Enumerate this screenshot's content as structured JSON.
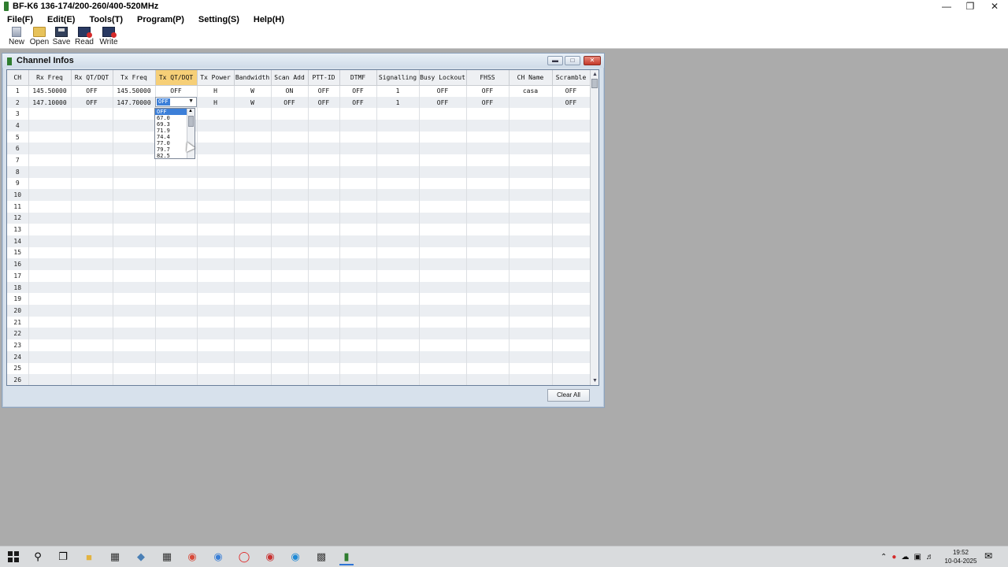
{
  "window": {
    "title": "BF-K6    136-174/200-260/400-520MHz",
    "min_icon": "minimize-icon",
    "max_icon": "restore-icon",
    "close_icon": "close-icon"
  },
  "menu": [
    {
      "label": "File(F)"
    },
    {
      "label": "Edit(E)"
    },
    {
      "label": "Tools(T)"
    },
    {
      "label": "Program(P)"
    },
    {
      "label": "Setting(S)"
    },
    {
      "label": "Help(H)"
    }
  ],
  "toolbar": {
    "new_label": "New",
    "open_label": "Open",
    "save_label": "Save",
    "read_label": "Read",
    "write_label": "Write"
  },
  "channel_window": {
    "title": "Channel Infos",
    "clear_all_label": "Clear All"
  },
  "table": {
    "columns": [
      "CH",
      "Rx Freq",
      "Rx QT/DQT",
      "Tx Freq",
      "Tx QT/DQT",
      "Tx Power",
      "Bandwidth",
      "Scan Add",
      "PTT-ID",
      "DTMF",
      "Signalling",
      "Busy Lockout",
      "FHSS",
      "CH Name",
      "Scramble"
    ],
    "active_column": "Tx QT/DQT",
    "rows": [
      [
        "1",
        "145.50000",
        "OFF",
        "145.50000",
        "OFF",
        "H",
        "W",
        "ON",
        "OFF",
        "OFF",
        "1",
        "OFF",
        "OFF",
        "casa",
        "OFF"
      ],
      [
        "2",
        "147.10000",
        "OFF",
        "147.70000",
        "",
        "H",
        "W",
        "OFF",
        "OFF",
        "OFF",
        "1",
        "OFF",
        "OFF",
        "",
        "OFF"
      ],
      [
        "3",
        "",
        "",
        "",
        "",
        "",
        "",
        "",
        "",
        "",
        "",
        "",
        "",
        "",
        ""
      ],
      [
        "4",
        "",
        "",
        "",
        "",
        "",
        "",
        "",
        "",
        "",
        "",
        "",
        "",
        "",
        ""
      ],
      [
        "5",
        "",
        "",
        "",
        "",
        "",
        "",
        "",
        "",
        "",
        "",
        "",
        "",
        "",
        ""
      ],
      [
        "6",
        "",
        "",
        "",
        "",
        "",
        "",
        "",
        "",
        "",
        "",
        "",
        "",
        "",
        ""
      ],
      [
        "7",
        "",
        "",
        "",
        "",
        "",
        "",
        "",
        "",
        "",
        "",
        "",
        "",
        "",
        ""
      ],
      [
        "8",
        "",
        "",
        "",
        "",
        "",
        "",
        "",
        "",
        "",
        "",
        "",
        "",
        "",
        ""
      ],
      [
        "9",
        "",
        "",
        "",
        "",
        "",
        "",
        "",
        "",
        "",
        "",
        "",
        "",
        "",
        ""
      ],
      [
        "10",
        "",
        "",
        "",
        "",
        "",
        "",
        "",
        "",
        "",
        "",
        "",
        "",
        "",
        ""
      ],
      [
        "11",
        "",
        "",
        "",
        "",
        "",
        "",
        "",
        "",
        "",
        "",
        "",
        "",
        "",
        ""
      ],
      [
        "12",
        "",
        "",
        "",
        "",
        "",
        "",
        "",
        "",
        "",
        "",
        "",
        "",
        "",
        ""
      ],
      [
        "13",
        "",
        "",
        "",
        "",
        "",
        "",
        "",
        "",
        "",
        "",
        "",
        "",
        "",
        ""
      ],
      [
        "14",
        "",
        "",
        "",
        "",
        "",
        "",
        "",
        "",
        "",
        "",
        "",
        "",
        "",
        ""
      ],
      [
        "15",
        "",
        "",
        "",
        "",
        "",
        "",
        "",
        "",
        "",
        "",
        "",
        "",
        "",
        ""
      ],
      [
        "16",
        "",
        "",
        "",
        "",
        "",
        "",
        "",
        "",
        "",
        "",
        "",
        "",
        "",
        ""
      ],
      [
        "17",
        "",
        "",
        "",
        "",
        "",
        "",
        "",
        "",
        "",
        "",
        "",
        "",
        "",
        ""
      ],
      [
        "18",
        "",
        "",
        "",
        "",
        "",
        "",
        "",
        "",
        "",
        "",
        "",
        "",
        "",
        ""
      ],
      [
        "19",
        "",
        "",
        "",
        "",
        "",
        "",
        "",
        "",
        "",
        "",
        "",
        "",
        "",
        ""
      ],
      [
        "20",
        "",
        "",
        "",
        "",
        "",
        "",
        "",
        "",
        "",
        "",
        "",
        "",
        "",
        ""
      ],
      [
        "21",
        "",
        "",
        "",
        "",
        "",
        "",
        "",
        "",
        "",
        "",
        "",
        "",
        "",
        ""
      ],
      [
        "22",
        "",
        "",
        "",
        "",
        "",
        "",
        "",
        "",
        "",
        "",
        "",
        "",
        "",
        ""
      ],
      [
        "23",
        "",
        "",
        "",
        "",
        "",
        "",
        "",
        "",
        "",
        "",
        "",
        "",
        "",
        ""
      ],
      [
        "24",
        "",
        "",
        "",
        "",
        "",
        "",
        "",
        "",
        "",
        "",
        "",
        "",
        "",
        ""
      ],
      [
        "25",
        "",
        "",
        "",
        "",
        "",
        "",
        "",
        "",
        "",
        "",
        "",
        "",
        "",
        ""
      ],
      [
        "26",
        "",
        "",
        "",
        "",
        "",
        "",
        "",
        "",
        "",
        "",
        "",
        "",
        "",
        ""
      ]
    ]
  },
  "dropdown": {
    "current_value": "OFF",
    "options": [
      "OFF",
      "67.0",
      "69.3",
      "71.9",
      "74.4",
      "77.0",
      "79.7",
      "82.5"
    ],
    "selected_index": 0
  },
  "taskbar": {
    "icons": [
      "start-icon",
      "search-icon",
      "task-view-icon",
      "file-explorer-icon",
      "store-icon",
      "app-icon",
      "calculator-icon",
      "chrome-icon",
      "app-icon",
      "opera-icon",
      "app-icon",
      "edge-icon",
      "app-icon",
      "radio-programmer-icon"
    ],
    "clock_time": "19:52",
    "clock_date": "10-04-2025"
  },
  "colors": {
    "active_header": "#f6cf77",
    "selection": "#3c7fd8",
    "desktop_bg": "#ababab"
  }
}
